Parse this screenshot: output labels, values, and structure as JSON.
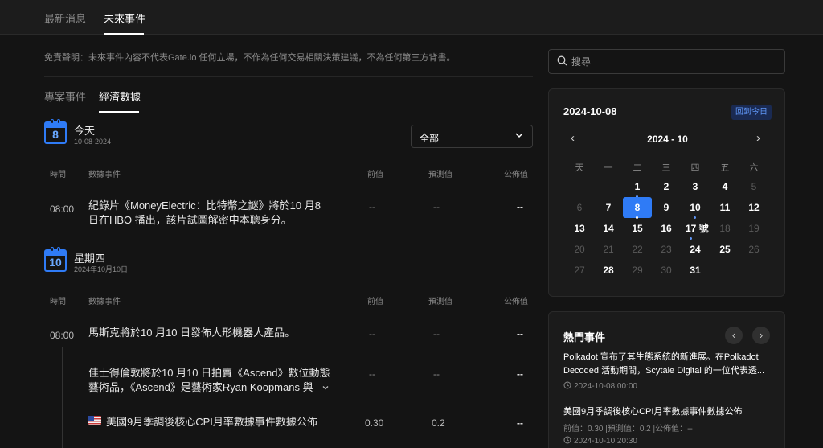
{
  "top_tabs": [
    "最新消息",
    "未來事件"
  ],
  "disclaimer": "免責聲明：未來事件內容不代表Gate.io 任何立場，不作為任何交易相關決策建議，不為任何第三方背書。",
  "sub_tabs": [
    "專案事件",
    "經濟數據"
  ],
  "filter": {
    "label": "全部"
  },
  "columns": {
    "time": "時間",
    "event": "數據事件",
    "previous": "前值",
    "forecast": "預測值",
    "published": "公佈值"
  },
  "days": [
    {
      "badge_day": "8",
      "title": "今天",
      "date": "10-08-2024",
      "rows": [
        {
          "time": "08:00",
          "text_lines": [
            "紀錄片《MoneyElectric：比特幣之謎》將於10 月8",
            "日在HBO 播出，該片試圖解密中本聰身分。"
          ],
          "previous": "--",
          "forecast": "--",
          "published": "--"
        }
      ]
    },
    {
      "badge_day": "10",
      "title": "星期四",
      "date": "2024年10月10日",
      "rows": [
        {
          "time": "08:00",
          "text_lines": [
            "馬斯克將於10 月10 日發佈人形機器人產品。"
          ],
          "previous": "--",
          "forecast": "--",
          "published": "--"
        },
        {
          "time": "",
          "text_lines": [
            "佳士得倫敦將於10 月10 日拍賣《Ascend》數位動態",
            "藝術品，《Ascend》是藝術家Ryan Koopmans 與"
          ],
          "previous": "--",
          "forecast": "--",
          "published": "--"
        },
        {
          "time": "",
          "text_lines": [
            "美國9月季調後核心CPI月率數據事件數據公佈"
          ],
          "previous": "0.30",
          "forecast": "0.2",
          "published": "--"
        }
      ]
    }
  ],
  "search": {
    "placeholder": "搜尋"
  },
  "calendar": {
    "selected_date": "2024-10-08",
    "back_today": "回到今日",
    "month_label": "2024 - 10",
    "weekdays": [
      "天",
      "一",
      "二",
      "三",
      "四",
      "五",
      "六"
    ],
    "weeks": [
      [
        "",
        "",
        "1",
        "2",
        "3",
        "4",
        "5"
      ],
      [
        "6",
        "7",
        "8",
        "9",
        "10",
        "11",
        "12"
      ],
      [
        "13",
        "14",
        "15",
        "16",
        "17 號",
        "18",
        "19"
      ],
      [
        "20",
        "21",
        "22",
        "23",
        "24",
        "25",
        "26"
      ],
      [
        "27",
        "28",
        "29",
        "30",
        "31",
        "",
        ""
      ]
    ]
  },
  "hot_events": {
    "title": "熱門事件",
    "items": [
      {
        "lines": [
          "Polkadot 宣布了其生態系統的新進展。在Polkadot",
          "Decoded 活動期間，Scytale Digital 的一位代表透..."
        ],
        "meta": "2024-10-08 00:00"
      },
      {
        "lines": [
          "美國9月季調後核心CPI月率數據事件數據公佈"
        ],
        "detail": "前值：0.30 |預測值：0.2 |公佈值：--",
        "meta": "2024-10-10 20:30"
      }
    ]
  },
  "colors": {
    "accent": "#2f7bf6",
    "background": "#141414",
    "card": "#1b1b1b"
  }
}
